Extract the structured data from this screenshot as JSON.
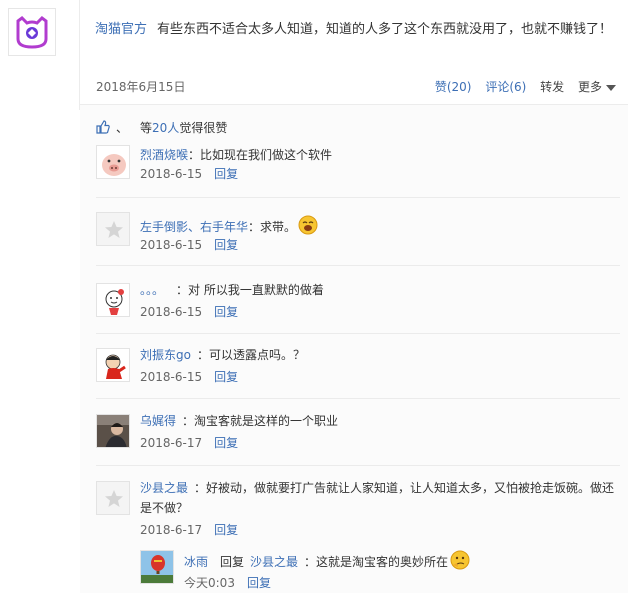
{
  "post": {
    "author": "淘猫官方",
    "text": "有些东西不适合太多人知道，知道的人多了这个东西就没用了，也就不赚钱了！",
    "date": "2018年6月15日",
    "actions": {
      "like": "赞(20)",
      "comment": "评论(6)",
      "forward": "转发",
      "more": "更多"
    }
  },
  "likes": {
    "sep": "、",
    "prefix": "等",
    "count": "20人",
    "suffix": "觉得很赞"
  },
  "reply_label": "回复",
  "comments": [
    {
      "name": "烈酒烧喉",
      "text": "：比如现在我们做这个软件",
      "date": "2018-6-15",
      "reply": "回复"
    },
    {
      "name": "左手倒影、右手年华",
      "text": "：求带。",
      "date": "2018-6-15",
      "reply": "回复"
    },
    {
      "name": "。。。",
      "text": "：对 所以我一直默默的做着",
      "date": "2018-6-15",
      "reply": "回复"
    },
    {
      "name": "刘振东go",
      "text": "：可以透露点吗。？",
      "date": "2018-6-15",
      "reply": "回复"
    },
    {
      "name": "乌娓得",
      "text": "：淘宝客就是这样的一个职业",
      "date": "2018-6-17",
      "reply": "回复"
    },
    {
      "name": "沙县之最",
      "text": "：好被动，做就要打广告就让人家知道，让人知道太多，又怕被抢走饭碗。做还是不做？",
      "date": "2018-6-17",
      "reply": "回复"
    }
  ],
  "sub_reply": {
    "name": "冰雨",
    "reply_word": "回复",
    "target": "沙县之最",
    "text": "：这就是淘宝客的奥妙所在",
    "date": "今天0:03",
    "reply": "回复"
  },
  "colors": {
    "link": "#3d6fb5",
    "brand": "#8b3cc8",
    "text": "#333333",
    "meta": "#666666"
  }
}
